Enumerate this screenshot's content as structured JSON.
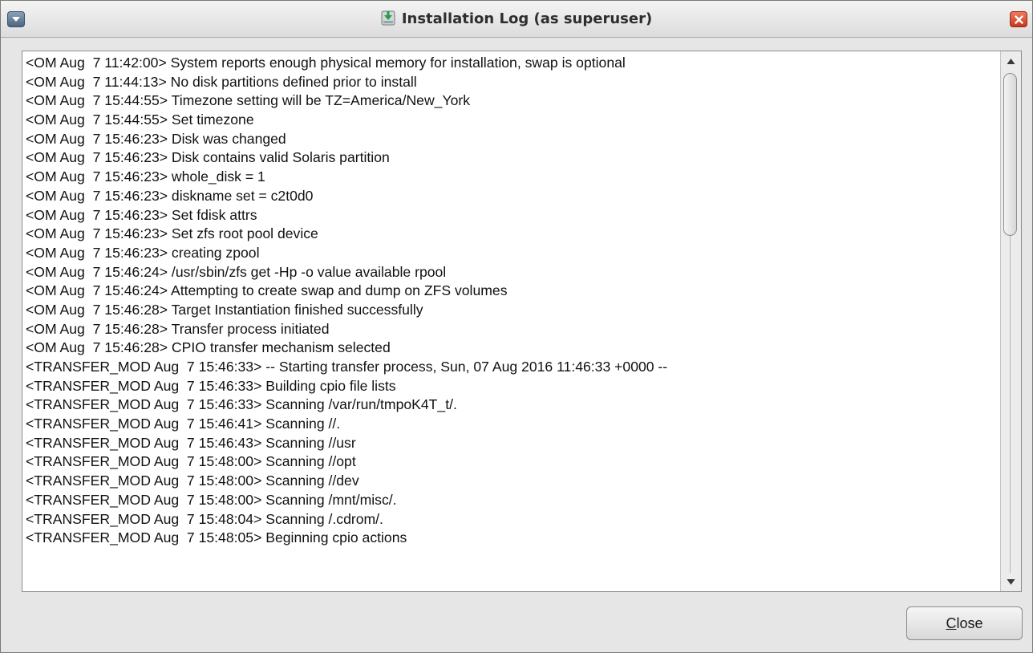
{
  "window": {
    "title": "Installation Log (as superuser)",
    "title_icon": "installer-icon",
    "menu_icon": "window-menu-icon",
    "close_icon": "close-icon"
  },
  "log": {
    "lines": [
      "<OM Aug  7 11:42:00> System reports enough physical memory for installation, swap is optional",
      "<OM Aug  7 11:44:13> No disk partitions defined prior to install",
      "<OM Aug  7 15:44:55> Timezone setting will be TZ=America/New_York",
      "<OM Aug  7 15:44:55> Set timezone",
      "<OM Aug  7 15:46:23> Disk was changed",
      "<OM Aug  7 15:46:23> Disk contains valid Solaris partition",
      "<OM Aug  7 15:46:23> whole_disk = 1",
      "<OM Aug  7 15:46:23> diskname set = c2t0d0",
      "<OM Aug  7 15:46:23> Set fdisk attrs",
      "<OM Aug  7 15:46:23> Set zfs root pool device",
      "<OM Aug  7 15:46:23> creating zpool",
      "<OM Aug  7 15:46:24> /usr/sbin/zfs get -Hp -o value available rpool",
      "<OM Aug  7 15:46:24> Attempting to create swap and dump on ZFS volumes",
      "<OM Aug  7 15:46:28> Target Instantiation finished successfully",
      "<OM Aug  7 15:46:28> Transfer process initiated",
      "<OM Aug  7 15:46:28> CPIO transfer mechanism selected",
      "<TRANSFER_MOD Aug  7 15:46:33> -- Starting transfer process, Sun, 07 Aug 2016 11:46:33 +0000 --",
      "<TRANSFER_MOD Aug  7 15:46:33> Building cpio file lists",
      "<TRANSFER_MOD Aug  7 15:46:33> Scanning /var/run/tmpoK4T_t/.",
      "<TRANSFER_MOD Aug  7 15:46:41> Scanning //.",
      "<TRANSFER_MOD Aug  7 15:46:43> Scanning //usr",
      "<TRANSFER_MOD Aug  7 15:48:00> Scanning //opt",
      "<TRANSFER_MOD Aug  7 15:48:00> Scanning //dev",
      "<TRANSFER_MOD Aug  7 15:48:00> Scanning /mnt/misc/.",
      "<TRANSFER_MOD Aug  7 15:48:04> Scanning /.cdrom/.",
      "<TRANSFER_MOD Aug  7 15:48:05> Beginning cpio actions"
    ]
  },
  "scrollbar": {
    "up_icon": "arrow-up-icon",
    "down_icon": "arrow-down-icon"
  },
  "buttons": {
    "close_mnemonic": "C",
    "close_rest": "lose"
  }
}
